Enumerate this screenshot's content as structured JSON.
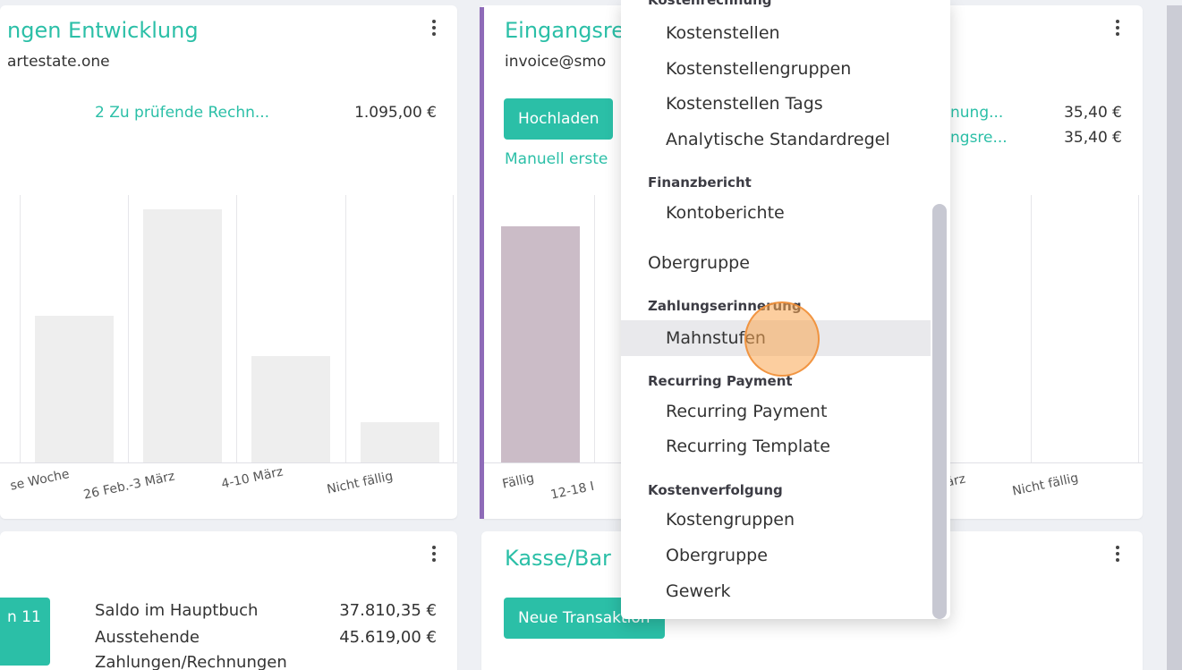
{
  "card1": {
    "title": "ngen Entwicklung",
    "email": "artestate.one",
    "review_link": "2 Zu prüfende Rechn...",
    "review_amount": "1.095,00 €",
    "chart_labels": [
      "se Woche",
      "26 Feb.-3 März",
      "4-10 März",
      "Nicht fällig"
    ]
  },
  "card2": {
    "title": "Eingangsre",
    "email": "invoice@smo",
    "upload_button": "Hochladen",
    "manual_link": "Manuell erste",
    "link1": "nung...",
    "amount1": "35,40 €",
    "link2": "ngsre...",
    "amount2": "35,40 €",
    "chart_labels": [
      "Fällig",
      "12-18 I",
      "ärz",
      "Nicht fällig"
    ]
  },
  "card3": {
    "button": "n 11",
    "row1_label": "Saldo im Hauptbuch",
    "row1_amount": "37.810,35 €",
    "row2_label": "Ausstehende",
    "row2_amount": "45.619,00 €",
    "row3_label": "Zahlungen/Rechnungen"
  },
  "card4": {
    "title": "Kasse/Bar",
    "button": "Neue Transaktion"
  },
  "menu": {
    "partial_header": "Kostenrechnung",
    "items_a": [
      "Kostenstellen",
      "Kostenstellengruppen",
      "Kostenstellen Tags",
      "Analytische Standardregel"
    ],
    "finanzbericht_header": "Finanzbericht",
    "kontoberichte": "Kontoberichte",
    "obergruppe_top": "Obergruppe",
    "zahlung_header": "Zahlungserinnerung",
    "mahnstufen": "Mahnstufen",
    "recurring_header": "Recurring Payment",
    "recurring_payment": "Recurring Payment",
    "recurring_template": "Recurring Template",
    "kostenverfolgung_header": "Kostenverfolgung",
    "kostengruppen": "Kostengruppen",
    "obergruppe": "Obergruppe",
    "gewerk": "Gewerk"
  },
  "colors": {
    "accent": "#2bbfa7",
    "bar_gray": "#eeeeee",
    "bar_mauve": "#cbbcc7",
    "stripe": "#8e6bb8"
  },
  "icons": [
    "kebab-menu-icon"
  ]
}
